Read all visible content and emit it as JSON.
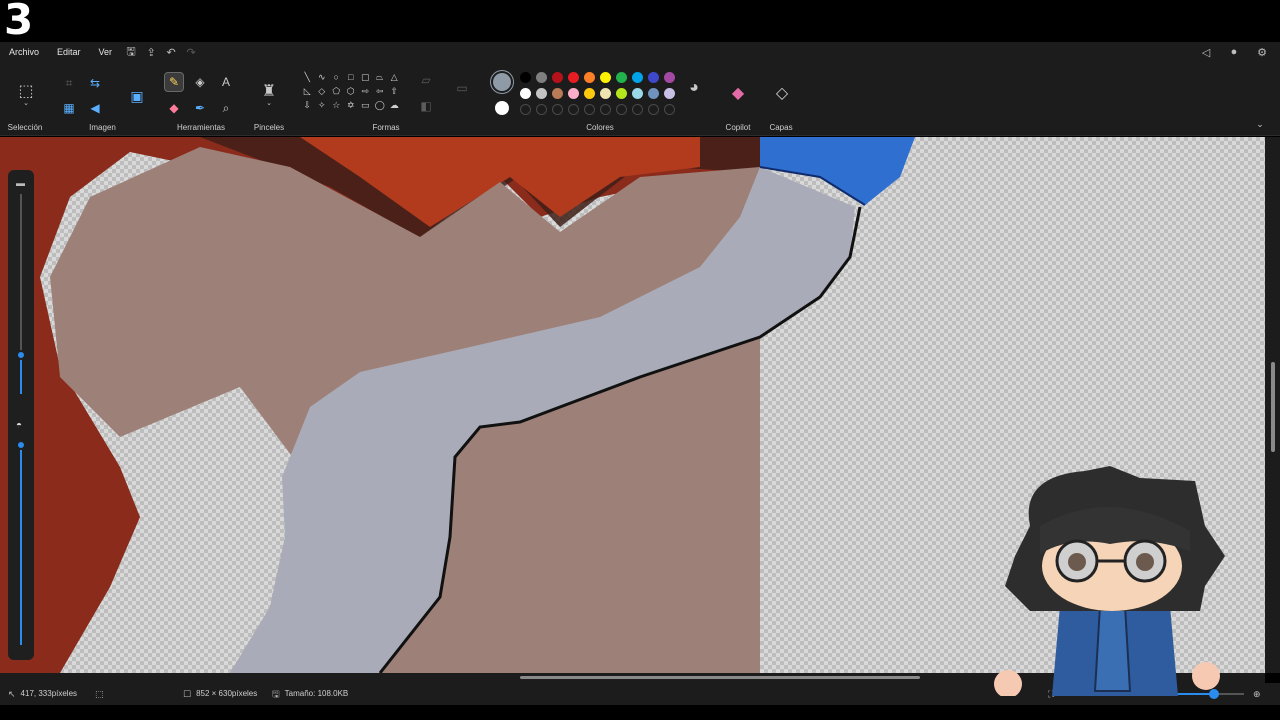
{
  "logo": {
    "glyph": "3"
  },
  "menu": {
    "items": [
      "Archivo",
      "Editar",
      "Ver"
    ]
  },
  "ribbon": {
    "groups": {
      "seleccion": "Selección",
      "imagen": "Imagen",
      "herramientas": "Herramientas",
      "pinceles": "Pinceles",
      "formas": "Formas",
      "colores": "Colores",
      "copilot": "Copilot",
      "capas": "Capas"
    },
    "active_tool": "pencil",
    "current_color": "#8f9aa7",
    "secondary_color": "#ffffff",
    "palette_row1": [
      "#000000",
      "#7f7f7f",
      "#b5121b",
      "#e81c23",
      "#ff7f27",
      "#fff200",
      "#22b14c",
      "#00a2e8",
      "#3f48cc",
      "#a349a4"
    ],
    "palette_row2": [
      "#ffffff",
      "#c3c3c3",
      "#b97a57",
      "#ffaec9",
      "#ffc90e",
      "#efe4b0",
      "#b5e61d",
      "#99d9ea",
      "#7092be",
      "#c8bfe7"
    ]
  },
  "status": {
    "cursor_pos": "417, 333píxeles",
    "image_size": "852 × 630píxeles",
    "file_size": "Tamaño: 108.0KB"
  },
  "zoom": {
    "level_fraction": 0.68
  }
}
